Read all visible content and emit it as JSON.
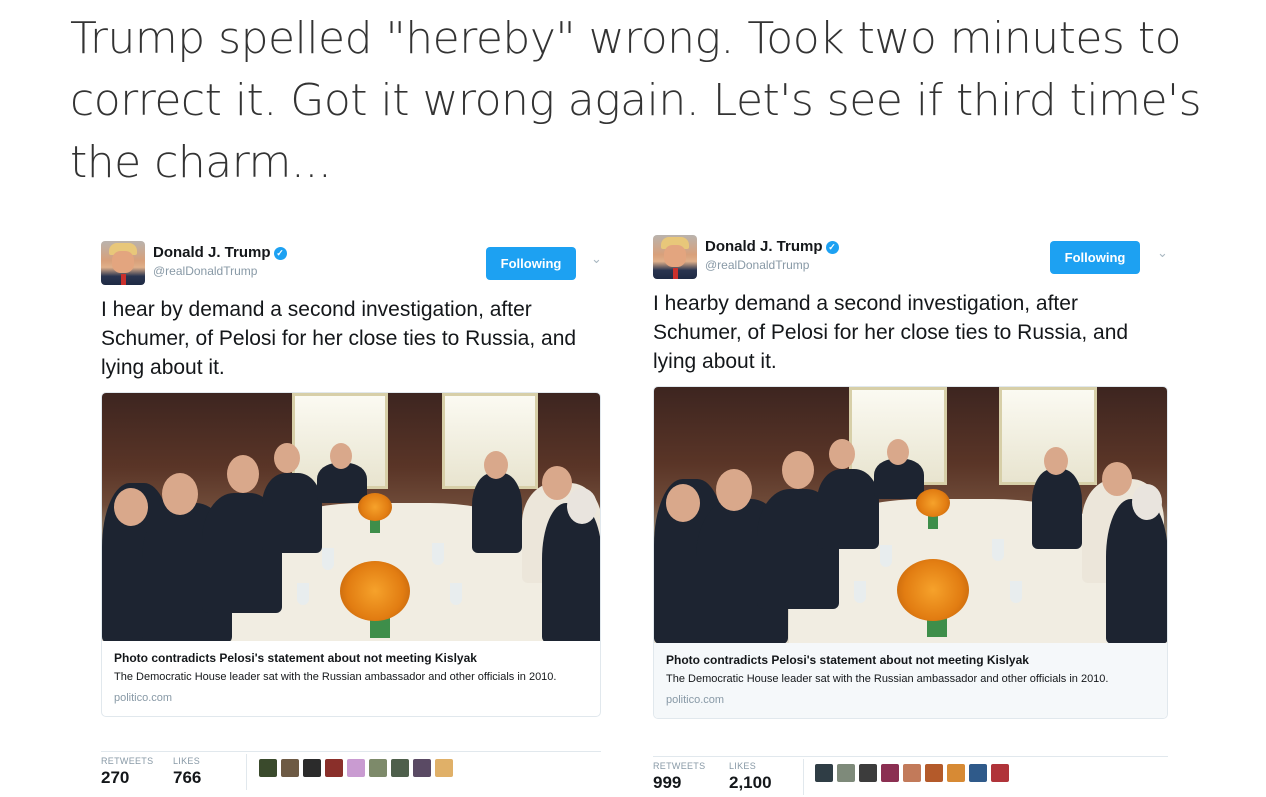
{
  "headline": "Trump spelled \"hereby\" wrong. Took two minutes to correct it. Got it wrong again. Let's see if third time's the charm...",
  "tweets": [
    {
      "name": "Donald J. Trump",
      "handle": "@realDonaldTrump",
      "follow_label": "Following",
      "chevron_icon": "chevron-down-icon",
      "verified_icon": "verified-badge-icon",
      "text": "I hear by demand a second investigation, after Schumer, of Pelosi for her close ties to Russia, and lying about it.",
      "card": {
        "title": "Photo contradicts Pelosi's statement about not meeting Kislyak",
        "description": "The Democratic House leader sat with the Russian ambassador and other officials in 2010.",
        "domain": "politico.com"
      },
      "retweets_label": "RETWEETS",
      "retweets_value": "270",
      "likes_label": "LIKES",
      "likes_value": "766"
    },
    {
      "name": "Donald J. Trump",
      "handle": "@realDonaldTrump",
      "follow_label": "Following",
      "chevron_icon": "chevron-down-icon",
      "verified_icon": "verified-badge-icon",
      "text": "I hearby demand a second investigation, after Schumer, of Pelosi for her close ties to Russia, and lying about it.",
      "card": {
        "title": "Photo contradicts Pelosi's statement about not meeting Kislyak",
        "description": "The Democratic House leader sat with the Russian ambassador and other officials in 2010.",
        "domain": "politico.com"
      },
      "retweets_label": "RETWEETS",
      "retweets_value": "999",
      "likes_label": "LIKES",
      "likes_value": "2,100"
    }
  ],
  "colors": {
    "accent": "#1da1f2",
    "text": "#14171a",
    "muted": "#8899a6",
    "border": "#e1e8ed"
  }
}
